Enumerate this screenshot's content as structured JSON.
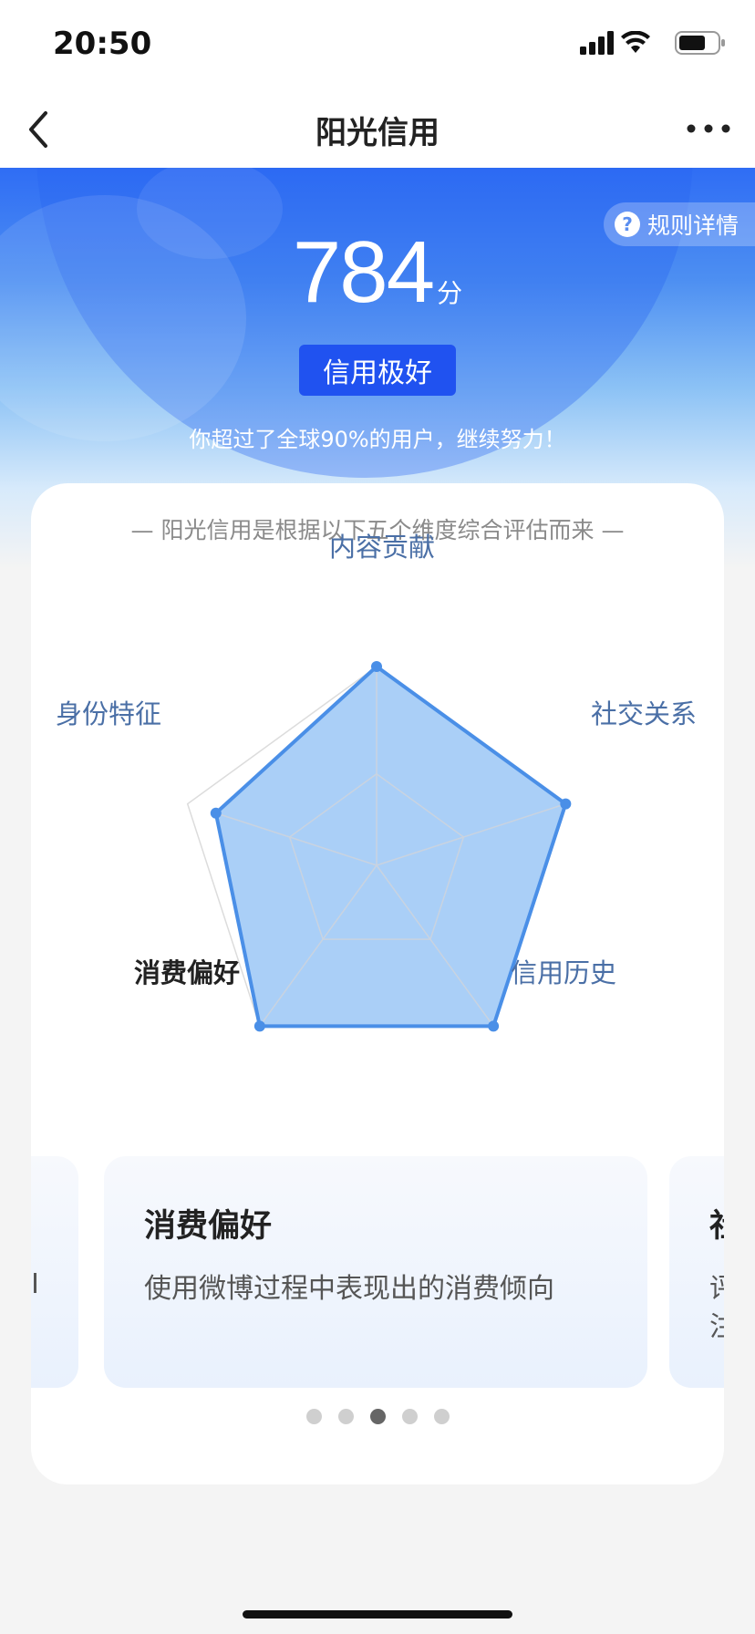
{
  "status_bar": {
    "time": "20:50"
  },
  "nav": {
    "title": "阳光信用"
  },
  "hero": {
    "rules_label": "规则详情",
    "score": "784",
    "score_unit": "分",
    "grade": "信用极好",
    "description": "你超过了全球90%的用户，继续努力！"
  },
  "card": {
    "subtitle": "— 阳光信用是根据以下五个维度综合评估而来 —"
  },
  "chart_data": {
    "type": "radar",
    "axes": [
      "内容贡献",
      "社交关系",
      "信用历史",
      "消费偏好",
      "身份特征"
    ],
    "values": [
      1.0,
      1.0,
      1.0,
      1.0,
      0.85
    ],
    "max": 1.0,
    "selected_axis": "消费偏好",
    "colors": {
      "fill": "#aacff7",
      "stroke": "#4a8fe7",
      "grid": "#c9d3e0"
    }
  },
  "carousel": {
    "current": {
      "title": "消费偏好",
      "description": "使用微博过程中表现出的消费倾向"
    },
    "next_preview": {
      "title": "社",
      "desc_line1": "评",
      "desc_line2": "注"
    },
    "active_index": 2,
    "total": 5
  }
}
